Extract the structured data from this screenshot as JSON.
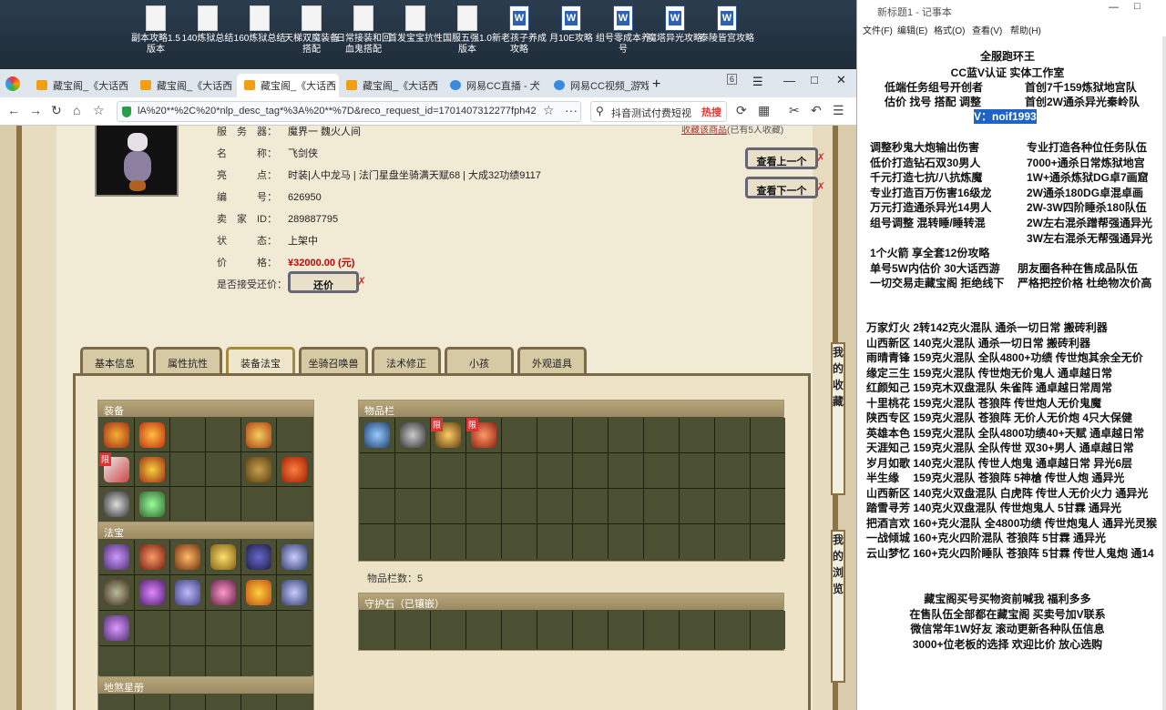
{
  "desktop": {
    "icons": [
      {
        "label": "副本攻略1.5版本",
        "type": "doc"
      },
      {
        "label": "140炼狱总结",
        "type": "doc"
      },
      {
        "label": "160炼狱总结",
        "type": "doc"
      },
      {
        "label": "天梯双魔装备搭配",
        "type": "doc"
      },
      {
        "label": "日常接装和回血鬼搭配",
        "type": "doc"
      },
      {
        "label": "首发宝宝抗性",
        "type": "doc"
      },
      {
        "label": "国服五强1.0版本",
        "type": "doc"
      },
      {
        "label": "新老孩子养成攻略",
        "type": "word"
      },
      {
        "label": "月10E攻略",
        "type": "word"
      },
      {
        "label": "组号零成本养号",
        "type": "word"
      },
      {
        "label": "魔塔异光攻略",
        "type": "word"
      },
      {
        "label": "泰陵皆宫攻略",
        "type": "word"
      }
    ]
  },
  "browser": {
    "tabs": [
      "藏宝阁_《大话西",
      "藏宝阁_《大话西",
      "藏宝阁_《大话西",
      "藏宝阁_《大话西",
      "网易CC直播 - 大",
      "网易CC视频_游戏"
    ],
    "new_tab": "+",
    "tab_count": "6",
    "url": "lA%20**%2C%20*nlp_desc_tag*%3A%20**%7D&reco_request_id=1701407312277fph42",
    "search": "抖音测试付费短视",
    "hot": "热搜"
  },
  "item": {
    "server_label": "服　务　器：",
    "server": "魔界一 魏火人间",
    "name_label": "名　　　称：",
    "name": "飞剑侠",
    "highlight_label": "亮　　　点：",
    "highlight": "时装|人中龙马 | 法门星盘坐骑满天赋68 | 大成32功绩9117",
    "id_label": "编　　　号：",
    "id": "626950",
    "seller_label": "卖　家　ID：",
    "seller": "289887795",
    "status_label": "状　　　态：",
    "status": "上架中",
    "price_label": "价　　　格：",
    "price": "¥32000.00 (元)",
    "bargain_label": "是否接受还价：",
    "bargain_btn": "还价",
    "fav": "收藏该商品",
    "fav_count": "(已有5人收藏)",
    "prev": "查看上一个",
    "next": "查看下一个"
  },
  "tabs": [
    "基本信息",
    "属性抗性",
    "装备法宝",
    "坐骑召唤兽",
    "法术修正",
    "小孩",
    "外观道具"
  ],
  "sections": {
    "equip": "装备",
    "treasure": "法宝",
    "star": "地煞星册",
    "bag": "物品栏",
    "bag_count": "物品栏数：5",
    "guard": "守护石（已镶嵌）",
    "limit": "限"
  },
  "side": [
    "我",
    "的",
    "收",
    "藏",
    "我",
    "的",
    "浏",
    "览"
  ],
  "notepad": {
    "title": "新标题1 - 记事本",
    "menu": [
      "文件(F)",
      "编辑(E)",
      "格式(O)",
      "查看(V)",
      "帮助(H)"
    ],
    "head": [
      {
        "l": "全服跑环王",
        "c": true
      },
      {
        "l": "CC蓝V认证    实体工作室",
        "c": true
      },
      {
        "l": "低端任务组号开创者",
        "r": "首创7千159炼狱地宫队"
      },
      {
        "l": "估价 找号 搭配 调整",
        "r": "首创2W通杀异光秦岭队"
      },
      {
        "l": "",
        "r": "V：noif1993",
        "hl": true
      }
    ],
    "services": [
      [
        "调整秒鬼大炮输出伤害",
        "专业打造各种位任务队伍"
      ],
      [
        "低价打造钻石双30男人",
        "7000+通杀日常炼狱地宫"
      ],
      [
        "千元打造七抗/八抗炼魔",
        "1W+通杀炼狱DG卓7画窟"
      ],
      [
        "专业打造百万伤害16级龙",
        "2W通杀180DG卓混卓画"
      ],
      [
        "万元打造通杀异光14男人",
        "2W-3W四阶睡杀180队伍"
      ],
      [
        "组号调整 混转睡/睡转混",
        "2W左右混杀蹭帮强通异光"
      ],
      [
        "",
        "3W左右混杀无帮强通异光"
      ],
      [
        "1个火箭 享全套12份攻略",
        ""
      ],
      [
        "单号5W内估价 30大话西游",
        "朋友圈各种在售成品队伍"
      ],
      [
        "一切交易走藏宝阁 拒绝线下",
        "严格把控价格 杜绝物次价高"
      ]
    ],
    "teams": [
      "万家灯火 2转142克火混队 通杀一切日常 搬砖利器",
      "山西新区 140克火混队 通杀一切日常 搬砖利器",
      "雨晴青锋 159克火混队 全队4800+功绩 传世炮其余全无价",
      "缘定三生 159克火混队 传世炮无价鬼人 通卓越日常",
      "红颜知己 159克木双盘混队 朱雀阵 通卓越日常周常",
      "十里桃花 159克火混队 苍狼阵 传世炮人无价鬼魔",
      "陕西专区 159克火混队 苍狼阵 无价人无价炮 4只大保健",
      "英雄本色 159克火混队 全队4800功绩40+天赋 通卓越日常",
      "天涯知己 159克火混队 全队传世 双30+男人 通卓越日常",
      "岁月如歌 140克火混队 传世人炮鬼 通卓越日常 异光6层",
      "半生缘　 159克火混队 苍狼阵 5神槍 传世人炮 通异光",
      "山西新区 140克火双盘混队 白虎阵 传世人无价火力 通异光",
      "踏雪寻芳 140克火双盘混队 传世炮鬼人 5甘霖 通异光",
      "把酒言欢 160+克火混队 全4800功绩 传世炮鬼人 通异光灵猴",
      "一战倾城 160+克火四阶混队 苍狼阵 5甘霖 通异光",
      "云山梦忆 160+克火四阶睡队 苍狼阵 5甘霖 传世人鬼炮 通14"
    ],
    "footer": [
      "藏宝阁买号买物资前喊我 福利多多",
      "在售队伍全部都在藏宝阁 买卖号加V联系",
      "微信常年1W好友 滚动更新各种队伍信息",
      "3000+位老板的选择 欢迎比价 放心选购"
    ]
  }
}
